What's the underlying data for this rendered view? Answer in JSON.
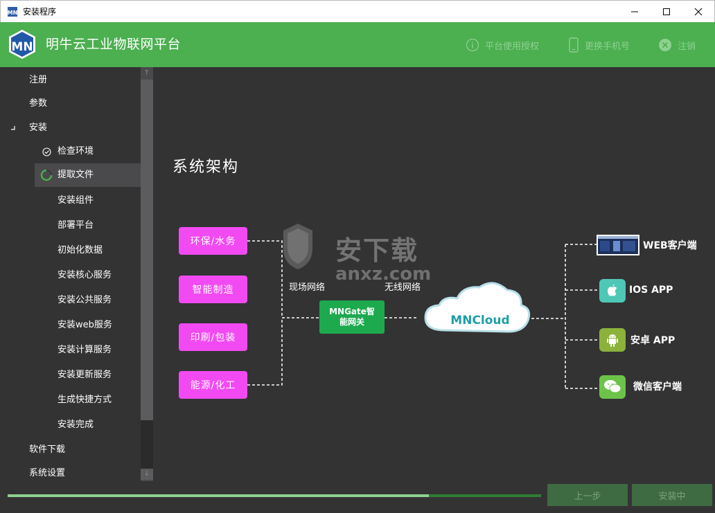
{
  "window": {
    "title": "安装程序"
  },
  "header": {
    "logo_text": "MN",
    "app_title": "明牛云工业物联网平台",
    "actions": [
      {
        "label": "平台使用授权",
        "icon": "info-circle-icon"
      },
      {
        "label": "更换手机号",
        "icon": "phone-icon"
      },
      {
        "label": "注销",
        "icon": "close-circle-icon"
      }
    ]
  },
  "sidebar": {
    "items": [
      {
        "label": "注册"
      },
      {
        "label": "参数"
      },
      {
        "label": "安装"
      },
      {
        "label": "检查环境"
      },
      {
        "label": "提取文件"
      },
      {
        "label": "安装组件"
      },
      {
        "label": "部署平台"
      },
      {
        "label": "初始化数据"
      },
      {
        "label": "安装核心服务"
      },
      {
        "label": "安装公共服务"
      },
      {
        "label": "安装web服务"
      },
      {
        "label": "安装计算服务"
      },
      {
        "label": "安装更新服务"
      },
      {
        "label": "生成快捷方式"
      },
      {
        "label": "安装完成"
      },
      {
        "label": "软件下载"
      },
      {
        "label": "系统设置"
      }
    ],
    "active_index": 4
  },
  "main": {
    "section_title": "系统架构",
    "industries": [
      "环保/水务",
      "智能制造",
      "印刷/包装",
      "能源/化工"
    ],
    "gateway_label": "MNGate智能网关",
    "gateway_line1": "MNGate智",
    "gateway_line2": "能网关",
    "field_network_label": "现场网络",
    "wireless_network_label": "无线网络",
    "cloud_label": "MNCloud",
    "clients": [
      {
        "label": "WEB客户端",
        "icon": "web-screenshot-icon"
      },
      {
        "label": "IOS APP",
        "icon": "apple-icon"
      },
      {
        "label": "安卓 APP",
        "icon": "android-icon"
      },
      {
        "label": "微信客户端",
        "icon": "wechat-icon"
      }
    ],
    "watermark": {
      "text": "安下载",
      "url": "anxz.com"
    }
  },
  "footer": {
    "progress": 0.79,
    "prev_label": "上一步",
    "install_label": "安装中"
  },
  "colors": {
    "accent_green": "#4caf50",
    "industry_magenta": "#f24af2",
    "gateway_green": "#1daa4f",
    "cloud_text": "#1e9fa7",
    "background": "#333334"
  }
}
